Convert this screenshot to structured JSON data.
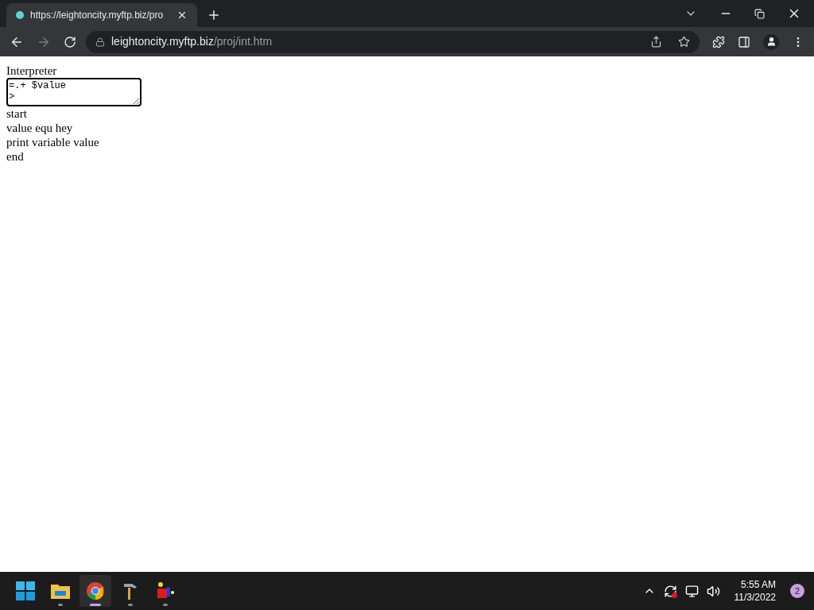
{
  "tab": {
    "title": "https://leightoncity.myftp.biz/pro",
    "selected": true
  },
  "address": {
    "host": "leightoncity.myftp.biz",
    "path": "/proj/int.htm"
  },
  "page": {
    "heading": "Interpreter",
    "textarea": {
      "value": "=.+ $value\n>"
    },
    "lines": [
      "start",
      "value equ hey",
      "print variable value",
      "end"
    ]
  },
  "taskbar": {
    "apps": [
      {
        "kind": "start",
        "running": false,
        "selected": false
      },
      {
        "kind": "folder",
        "running": true,
        "selected": false
      },
      {
        "kind": "browser",
        "running": true,
        "selected": true
      },
      {
        "kind": "tool",
        "running": true,
        "selected": false
      },
      {
        "kind": "blocks",
        "running": true,
        "selected": false
      }
    ],
    "time": "5:55 AM",
    "date": "11/3/2022",
    "notifications": "2"
  }
}
